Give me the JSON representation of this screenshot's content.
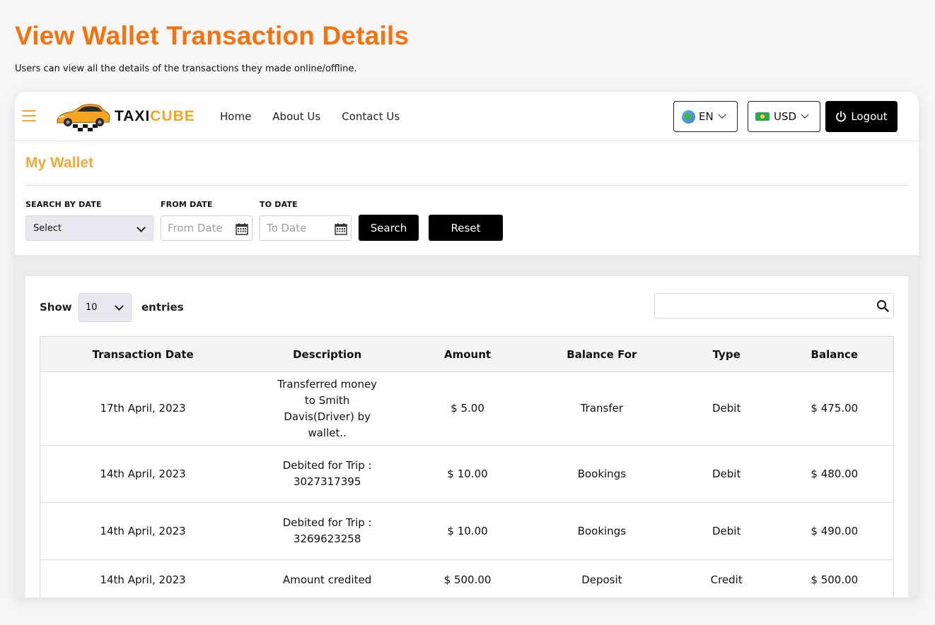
{
  "page": {
    "heading": "View Wallet Transaction Details",
    "subheading": "Users can view all the details of the transactions they made online/offline."
  },
  "navbar": {
    "brand_prefix": "TAXI",
    "brand_suffix": "CUBE",
    "links": [
      "Home",
      "About Us",
      "Contact Us"
    ],
    "language": "EN",
    "currency": "USD",
    "logout_label": "Logout",
    "accent_color": "#f5a524"
  },
  "wallet": {
    "title": "My Wallet",
    "filters": {
      "search_by_date_label": "SEARCH BY DATE",
      "search_by_date_value": "Select",
      "from_date_label": "FROM DATE",
      "from_date_placeholder": "From Date",
      "to_date_label": "TO DATE",
      "to_date_placeholder": "To Date",
      "search_button": "Search",
      "reset_button": "Reset"
    }
  },
  "table_controls": {
    "show_label": "Show",
    "entries_value": "10",
    "entries_label": "entries"
  },
  "table": {
    "columns": [
      "Transaction Date",
      "Description",
      "Amount",
      "Balance For",
      "Type",
      "Balance"
    ],
    "rows": [
      [
        "17th April, 2023",
        "Transferred money to Smith Davis(Driver) by wallet..",
        "$ 5.00",
        "Transfer",
        "Debit",
        "$ 475.00"
      ],
      [
        "14th April, 2023",
        "Debited for Trip : 3027317395",
        "$ 10.00",
        "Bookings",
        "Debit",
        "$ 480.00"
      ],
      [
        "14th April, 2023",
        "Debited for Trip : 3269623258",
        "$ 10.00",
        "Bookings",
        "Debit",
        "$ 490.00"
      ],
      [
        "14th April, 2023",
        "Amount credited",
        "$ 500.00",
        "Deposit",
        "Credit",
        "$ 500.00"
      ]
    ]
  },
  "colors": {
    "heading_orange": "#f5730f",
    "wallet_title": "#f2a93b",
    "button_black": "#000000"
  }
}
